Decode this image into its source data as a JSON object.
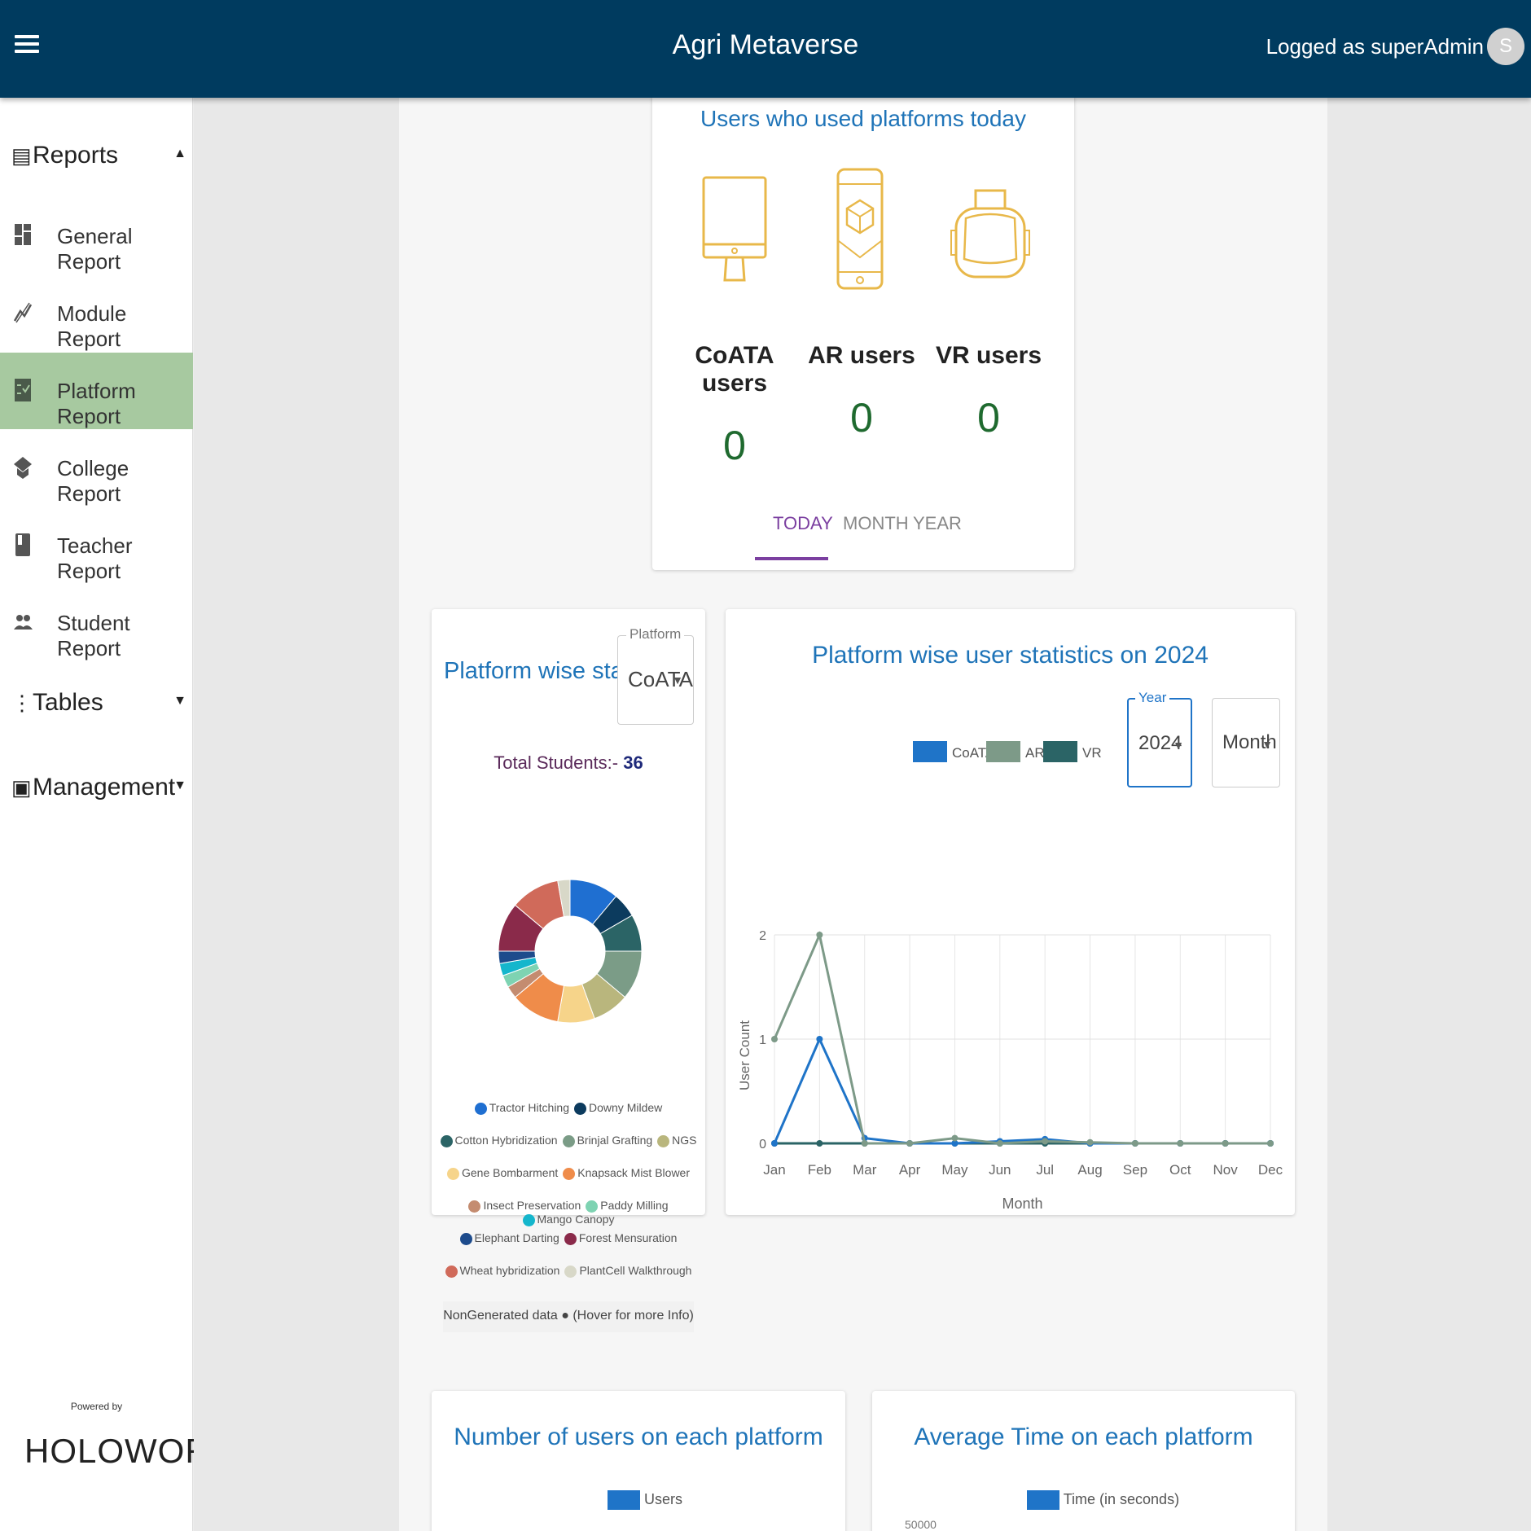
{
  "header": {
    "title": "Agri Metaverse",
    "user_text": "Logged as superAdmin",
    "avatar_initial": "S"
  },
  "sidebar": {
    "reports_label": "Reports",
    "items": [
      {
        "label": "General Report",
        "icon": "dashboard-icon"
      },
      {
        "label": "Module Report",
        "icon": "trend-icon"
      },
      {
        "label": "Platform Report",
        "icon": "checklist-icon"
      },
      {
        "label": "College Report",
        "icon": "school-icon"
      },
      {
        "label": "Teacher Report",
        "icon": "book-icon"
      },
      {
        "label": "Student Report",
        "icon": "people-icon"
      }
    ],
    "tables_label": "Tables",
    "management_label": "Management",
    "powered_by": "Powered by",
    "brand": "HOLOWORLD"
  },
  "today_card": {
    "title": "Users who used platforms today",
    "platforms": [
      {
        "name": "CoATA users",
        "value": "0"
      },
      {
        "name": "AR users",
        "value": "0"
      },
      {
        "name": "VR users",
        "value": "0"
      }
    ],
    "tabs": [
      "TODAY",
      "MONTH",
      "YEAR"
    ],
    "active_tab": "TODAY",
    "icon_color": "#e8b84a"
  },
  "platform_stats": {
    "title": "Platform wise statistics",
    "select_label": "Platform",
    "select_value": "CoATA",
    "total_label": "Total Students:-",
    "total_value": "36",
    "footer": "NonGenerated data",
    "footer_hint": "(Hover for more Info)"
  },
  "line_card": {
    "title": "Platform wise user statistics on 2024",
    "year_label": "Year",
    "year_value": "2024",
    "month_value": "Month"
  },
  "users_card": {
    "title": "Number of users on each platform",
    "legend": "Users"
  },
  "time_card": {
    "title": "Average Time on each platform",
    "legend": "Time (in seconds)",
    "top_tick": "50000"
  },
  "chart_data": [
    {
      "type": "pie",
      "labels": [
        "Tractor Hitching",
        "Downy Mildew",
        "Cotton Hybridization",
        "Brinjal Grafting",
        "NGS",
        "Gene Bombarment",
        "Knapsack Mist Blower",
        "Insect Preservation",
        "Paddy Milling",
        "Mango Canopy",
        "Elephant Darting",
        "Forest Mensuration",
        "Wheat hybridization",
        "PlantCell Walkthrough"
      ],
      "values": [
        4,
        2,
        3,
        4,
        3,
        3,
        4,
        1,
        1,
        1,
        1,
        4,
        4,
        1
      ],
      "colors": [
        "#1f6fd1",
        "#0c3b5e",
        "#2b6466",
        "#7b9c87",
        "#b9b67d",
        "#f6d48a",
        "#ef8c4a",
        "#c48c70",
        "#7ed3b2",
        "#15b6cc",
        "#1d4b8c",
        "#8a2a4a",
        "#d06a5a",
        "#d8d8c8"
      ]
    },
    {
      "type": "line",
      "title": "Platform wise user statistics on 2024",
      "categories": [
        "Jan",
        "Feb",
        "Mar",
        "Apr",
        "May",
        "Jun",
        "Jul",
        "Aug",
        "Sep",
        "Oct",
        "Nov",
        "Dec"
      ],
      "series": [
        {
          "name": "CoATA",
          "color": "#1f74c8",
          "values": [
            0,
            1,
            0.05,
            0,
            0,
            0.02,
            0.04,
            0,
            0,
            0,
            0,
            0
          ]
        },
        {
          "name": "AR",
          "color": "#7d9a88",
          "values": [
            1,
            2,
            0,
            0,
            0.05,
            0,
            0.02,
            0.01,
            0,
            0,
            0,
            0
          ]
        },
        {
          "name": "VR",
          "color": "#2b6466",
          "values": [
            0,
            0,
            0,
            0,
            0,
            0,
            0,
            0,
            0,
            0,
            0,
            0
          ]
        }
      ],
      "xlabel": "Month",
      "ylabel": "User Count",
      "ylim": [
        0,
        2
      ],
      "yticks": [
        "0",
        "1",
        "2"
      ]
    }
  ]
}
